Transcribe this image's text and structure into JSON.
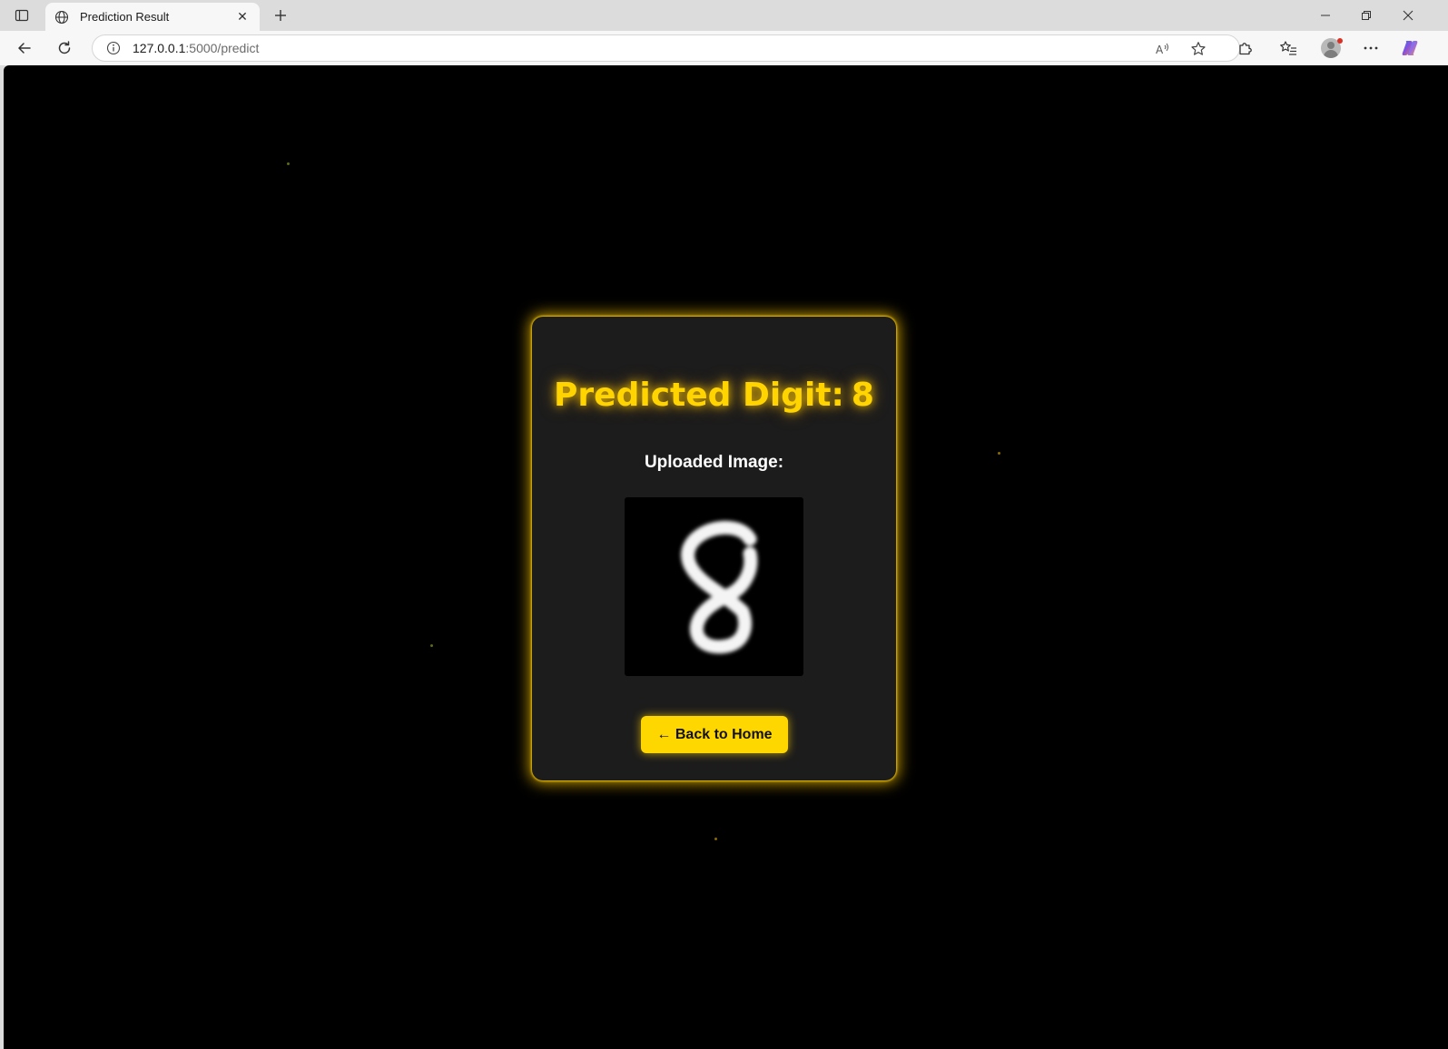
{
  "browser": {
    "tab": {
      "title": "Prediction Result",
      "icon": "globe-icon"
    },
    "address": {
      "host": "127.0.0.1",
      "port_path": ":5000/predict"
    }
  },
  "page": {
    "heading_prefix": "Predicted Digit:",
    "predicted_digit": "8",
    "image_label": "Uploaded Image:",
    "back_button": "← Back to Home"
  },
  "colors": {
    "accent": "#ffd700",
    "page_background": "#000000",
    "card_background": "#1c1c1c",
    "particle": "#8a6a00"
  }
}
